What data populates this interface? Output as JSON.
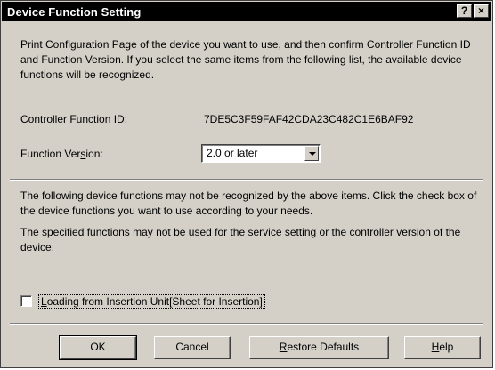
{
  "window": {
    "title": "Device Function Setting",
    "help_button": "?",
    "close_button": "×"
  },
  "intro": "Print Configuration Page of the device you want to use, and then confirm Controller Function ID and Function Version. If you select the same items from the following list, the available device functions will be recognized.",
  "controller": {
    "label": "Controller Function ID:",
    "value": "7DE5C3F59FAF42CDA23C482C1E6BAF92"
  },
  "version": {
    "label_pre": "Function Ver",
    "label_accel": "s",
    "label_post": "ion:",
    "selected": "2.0 or later"
  },
  "notes": {
    "line1": "The following device functions may not be recognized by the above items. Click the check box of the device functions you want to use according to your needs.",
    "line2": "The specified functions may not be used for the service setting or the controller version of the device."
  },
  "option": {
    "accel": "L",
    "label_rest": "oading from Insertion Unit[Sheet for Insertion]",
    "checked": false
  },
  "buttons": {
    "ok": "OK",
    "cancel": "Cancel",
    "restore_accel": "R",
    "restore_rest": "estore Defaults",
    "help_accel": "H",
    "help_rest": "elp"
  },
  "colors": {
    "dialog_face": "#d4d0c8",
    "titlebar": "#000000",
    "title_text": "#ffffff"
  }
}
